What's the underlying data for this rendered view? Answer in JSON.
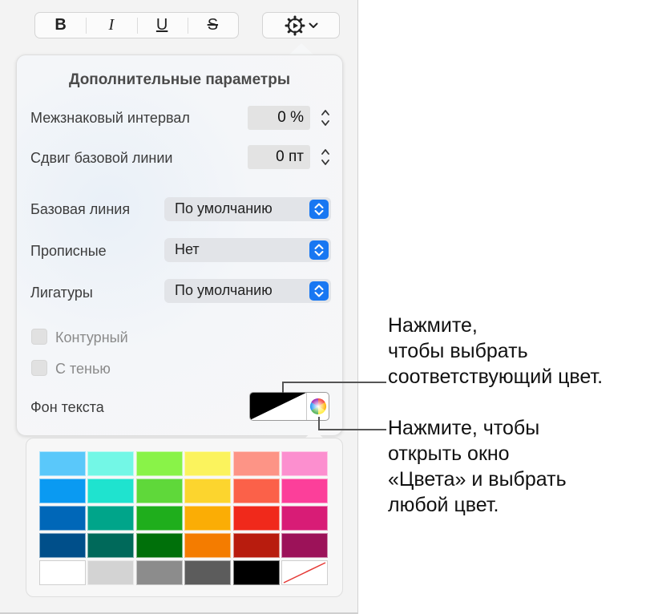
{
  "toolbar": {
    "bold": "B",
    "italic": "I",
    "underline": "U",
    "strikethrough": "S",
    "gear_icon": "gear-icon",
    "chevron_icon": "chevron-down-icon"
  },
  "popover": {
    "title": "Дополнительные параметры",
    "character_spacing": {
      "label": "Межзнаковый интервал",
      "value": "0 %"
    },
    "baseline_shift": {
      "label": "Сдвиг базовой линии",
      "value": "0 пт"
    },
    "baseline": {
      "label": "Базовая линия",
      "value": "По умолчанию"
    },
    "capitalization": {
      "label": "Прописные",
      "value": "Нет"
    },
    "ligatures": {
      "label": "Лигатуры",
      "value": "По умолчанию"
    },
    "outline": {
      "label": "Контурный",
      "checked": false
    },
    "shadow": {
      "label": "С тенью",
      "checked": false
    },
    "text_background": {
      "label": "Фон текста"
    }
  },
  "colors": {
    "accent": "#1877f2",
    "palette": [
      [
        "#5ac8fa",
        "#73f7e6",
        "#89f348",
        "#fbf35d",
        "#fd9486",
        "#fc8fcf"
      ],
      [
        "#0a9af2",
        "#1fe3cf",
        "#5fd83a",
        "#fcd52e",
        "#fb6149",
        "#fc3f9a"
      ],
      [
        "#0067b8",
        "#00a58a",
        "#1fae1c",
        "#fbad05",
        "#f0291b",
        "#d81c76"
      ],
      [
        "#004f8a",
        "#00695a",
        "#00700a",
        "#f47c00",
        "#b81c0e",
        "#9c1259"
      ],
      [
        "#ffffff",
        "#d3d3d3",
        "#8c8c8c",
        "#5c5c5c",
        "#000000",
        "none"
      ]
    ]
  },
  "callouts": {
    "first": "Нажмите,\nчтобы выбрать\nсоответствующий цвет.",
    "second": "Нажмите, чтобы\nоткрыть окно\n«Цвета» и выбрать\nлюбой цвет."
  }
}
